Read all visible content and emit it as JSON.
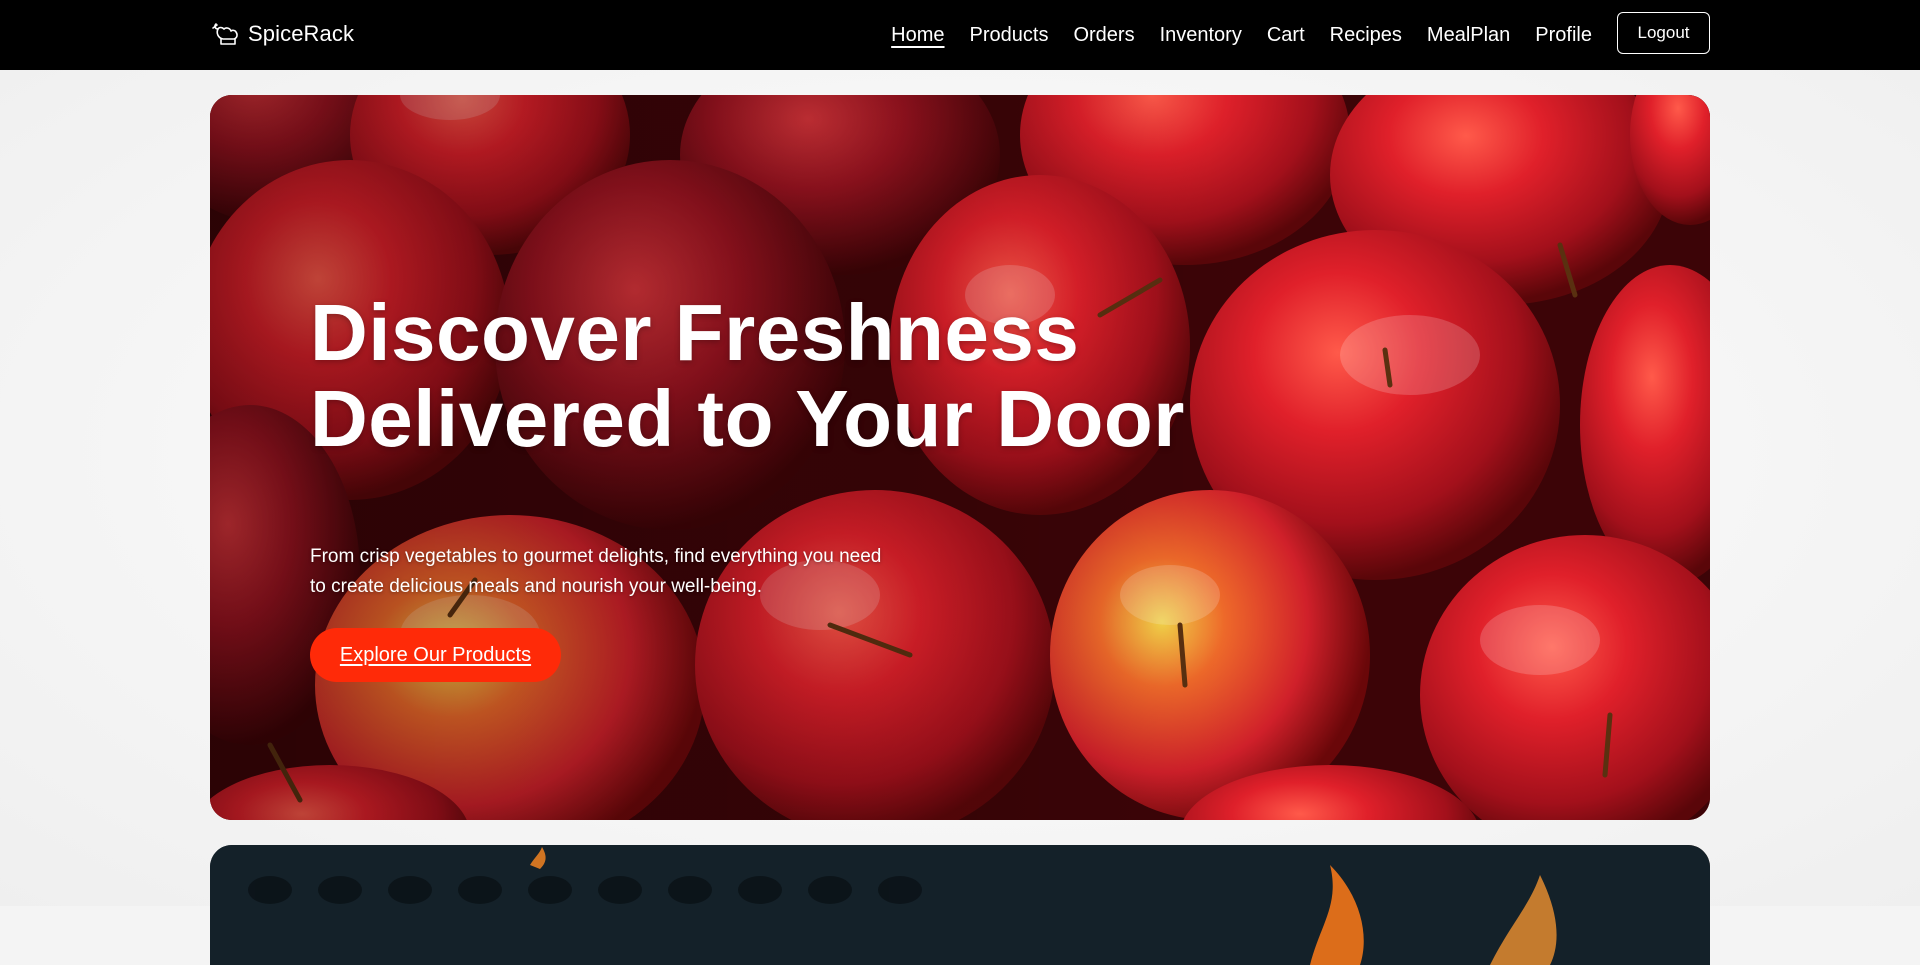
{
  "navbar": {
    "brand": "SpiceRack",
    "brand_icon": "chef-hat-icon",
    "links": [
      "Home",
      "Products",
      "Orders",
      "Inventory",
      "Cart",
      "Recipes",
      "MealPlan",
      "Profile"
    ],
    "active": "Home",
    "logout_label": "Logout"
  },
  "hero": {
    "title_line1": "Discover Freshness",
    "title_line2": "Delivered to Your Door",
    "subtitle_line1": "From crisp vegetables to gourmet delights, find everything you need",
    "subtitle_line2": "to create delicious meals and nourish your well-being.",
    "cta_label": "Explore Our Products",
    "background_image": "red-apples-photo"
  },
  "colors": {
    "nav_bg": "#000000",
    "cta_bg": "#ff2a08",
    "page_bg": "#f4f4f4"
  }
}
